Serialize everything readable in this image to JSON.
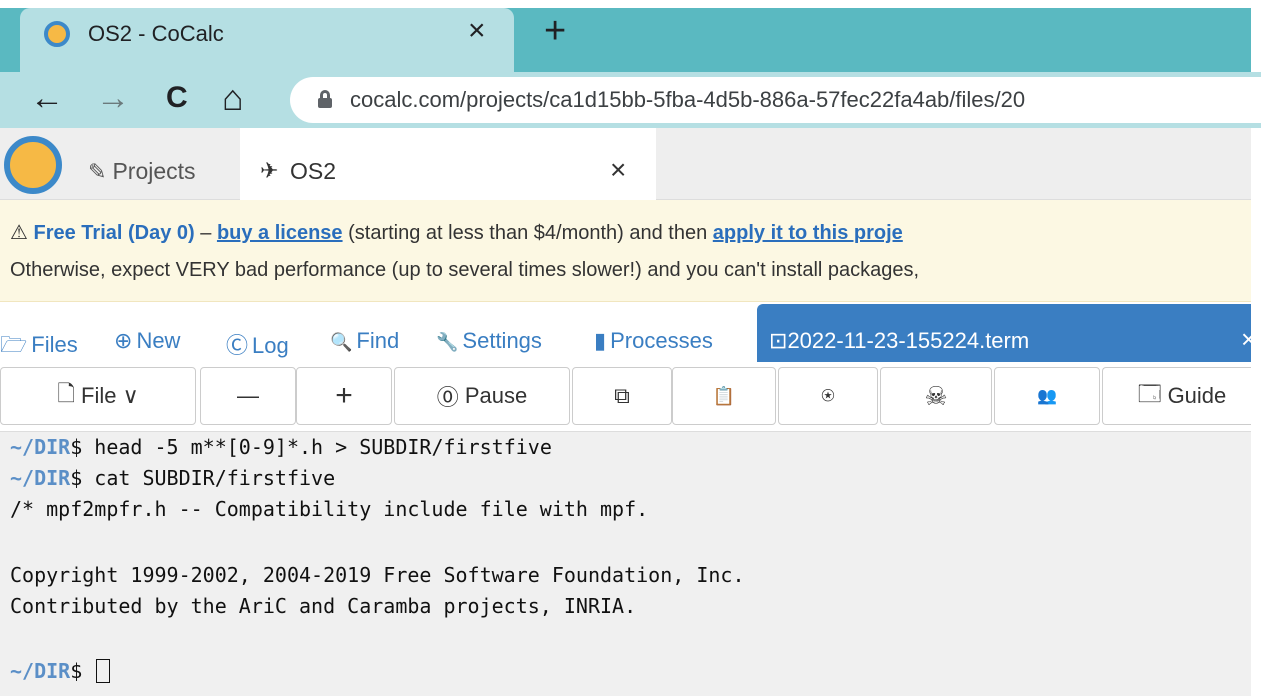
{
  "browser": {
    "tab_title": "OS2 - CoCalc",
    "tab_close": "×",
    "new_tab": "+",
    "back": "←",
    "forward": "→",
    "reload": "C",
    "home": "⌂",
    "url": "cocalc.com/projects/ca1d15bb-5fba-4d5b-886a-57fec22fa4ab/files/20"
  },
  "cocalc_nav": {
    "projects_icon": "✎",
    "projects_label": "Projects",
    "project_icon": "✈",
    "project_tab_title": "OS2",
    "project_tab_close": "×"
  },
  "banner": {
    "warning_icon": "⚠",
    "trial_label": "Free Trial (Day 0)",
    "dash": " – ",
    "buy_link": "buy a license",
    "middle_text": " (starting at less than $4/month) and then ",
    "apply_link": "apply it to this proje",
    "line2": "Otherwise, expect VERY bad performance (up to several times slower!) and you can't install packages,"
  },
  "project_tabs": [
    {
      "icon": "🗁",
      "label": "Files"
    },
    {
      "icon": "⊕",
      "label": "New"
    },
    {
      "icon": "Ⓒ",
      "label": "Log"
    },
    {
      "icon": "🔍",
      "label": "Find"
    },
    {
      "icon": "🔧",
      "label": "Settings"
    },
    {
      "icon": "▮",
      "label": "Processes"
    }
  ],
  "terminal_tab": {
    "icon": "⊡",
    "title": "2022-11-23-155224.term",
    "close": "×"
  },
  "toolbar": {
    "file_label": "File ∨",
    "file_icon": "🗋",
    "minus": "—",
    "plus": "+",
    "pause_label": "Pause",
    "pause_icon": "⓪",
    "copy_icon": "⧉",
    "paste_icon": "📋",
    "kick_icon": "⍟",
    "skull_icon": "☠",
    "users_icon": "👥",
    "guide_icon": "🗔",
    "guide_label": "Guide"
  },
  "terminal": {
    "prompt": "~/DIR",
    "lines": [
      {
        "prompt": true,
        "text": "$ head -5 m**[0-9]*.h > SUBDIR/firstfive"
      },
      {
        "prompt": true,
        "text": "$ cat SUBDIR/firstfive"
      },
      {
        "prompt": false,
        "text": "/* mpf2mpfr.h -- Compatibility include file with mpf."
      },
      {
        "prompt": false,
        "text": ""
      },
      {
        "prompt": false,
        "text": "Copyright 1999-2002, 2004-2019 Free Software Foundation, Inc."
      },
      {
        "prompt": false,
        "text": "Contributed by the AriC and Caramba projects, INRIA."
      },
      {
        "prompt": false,
        "text": ""
      },
      {
        "prompt": true,
        "text": "$ "
      }
    ]
  }
}
